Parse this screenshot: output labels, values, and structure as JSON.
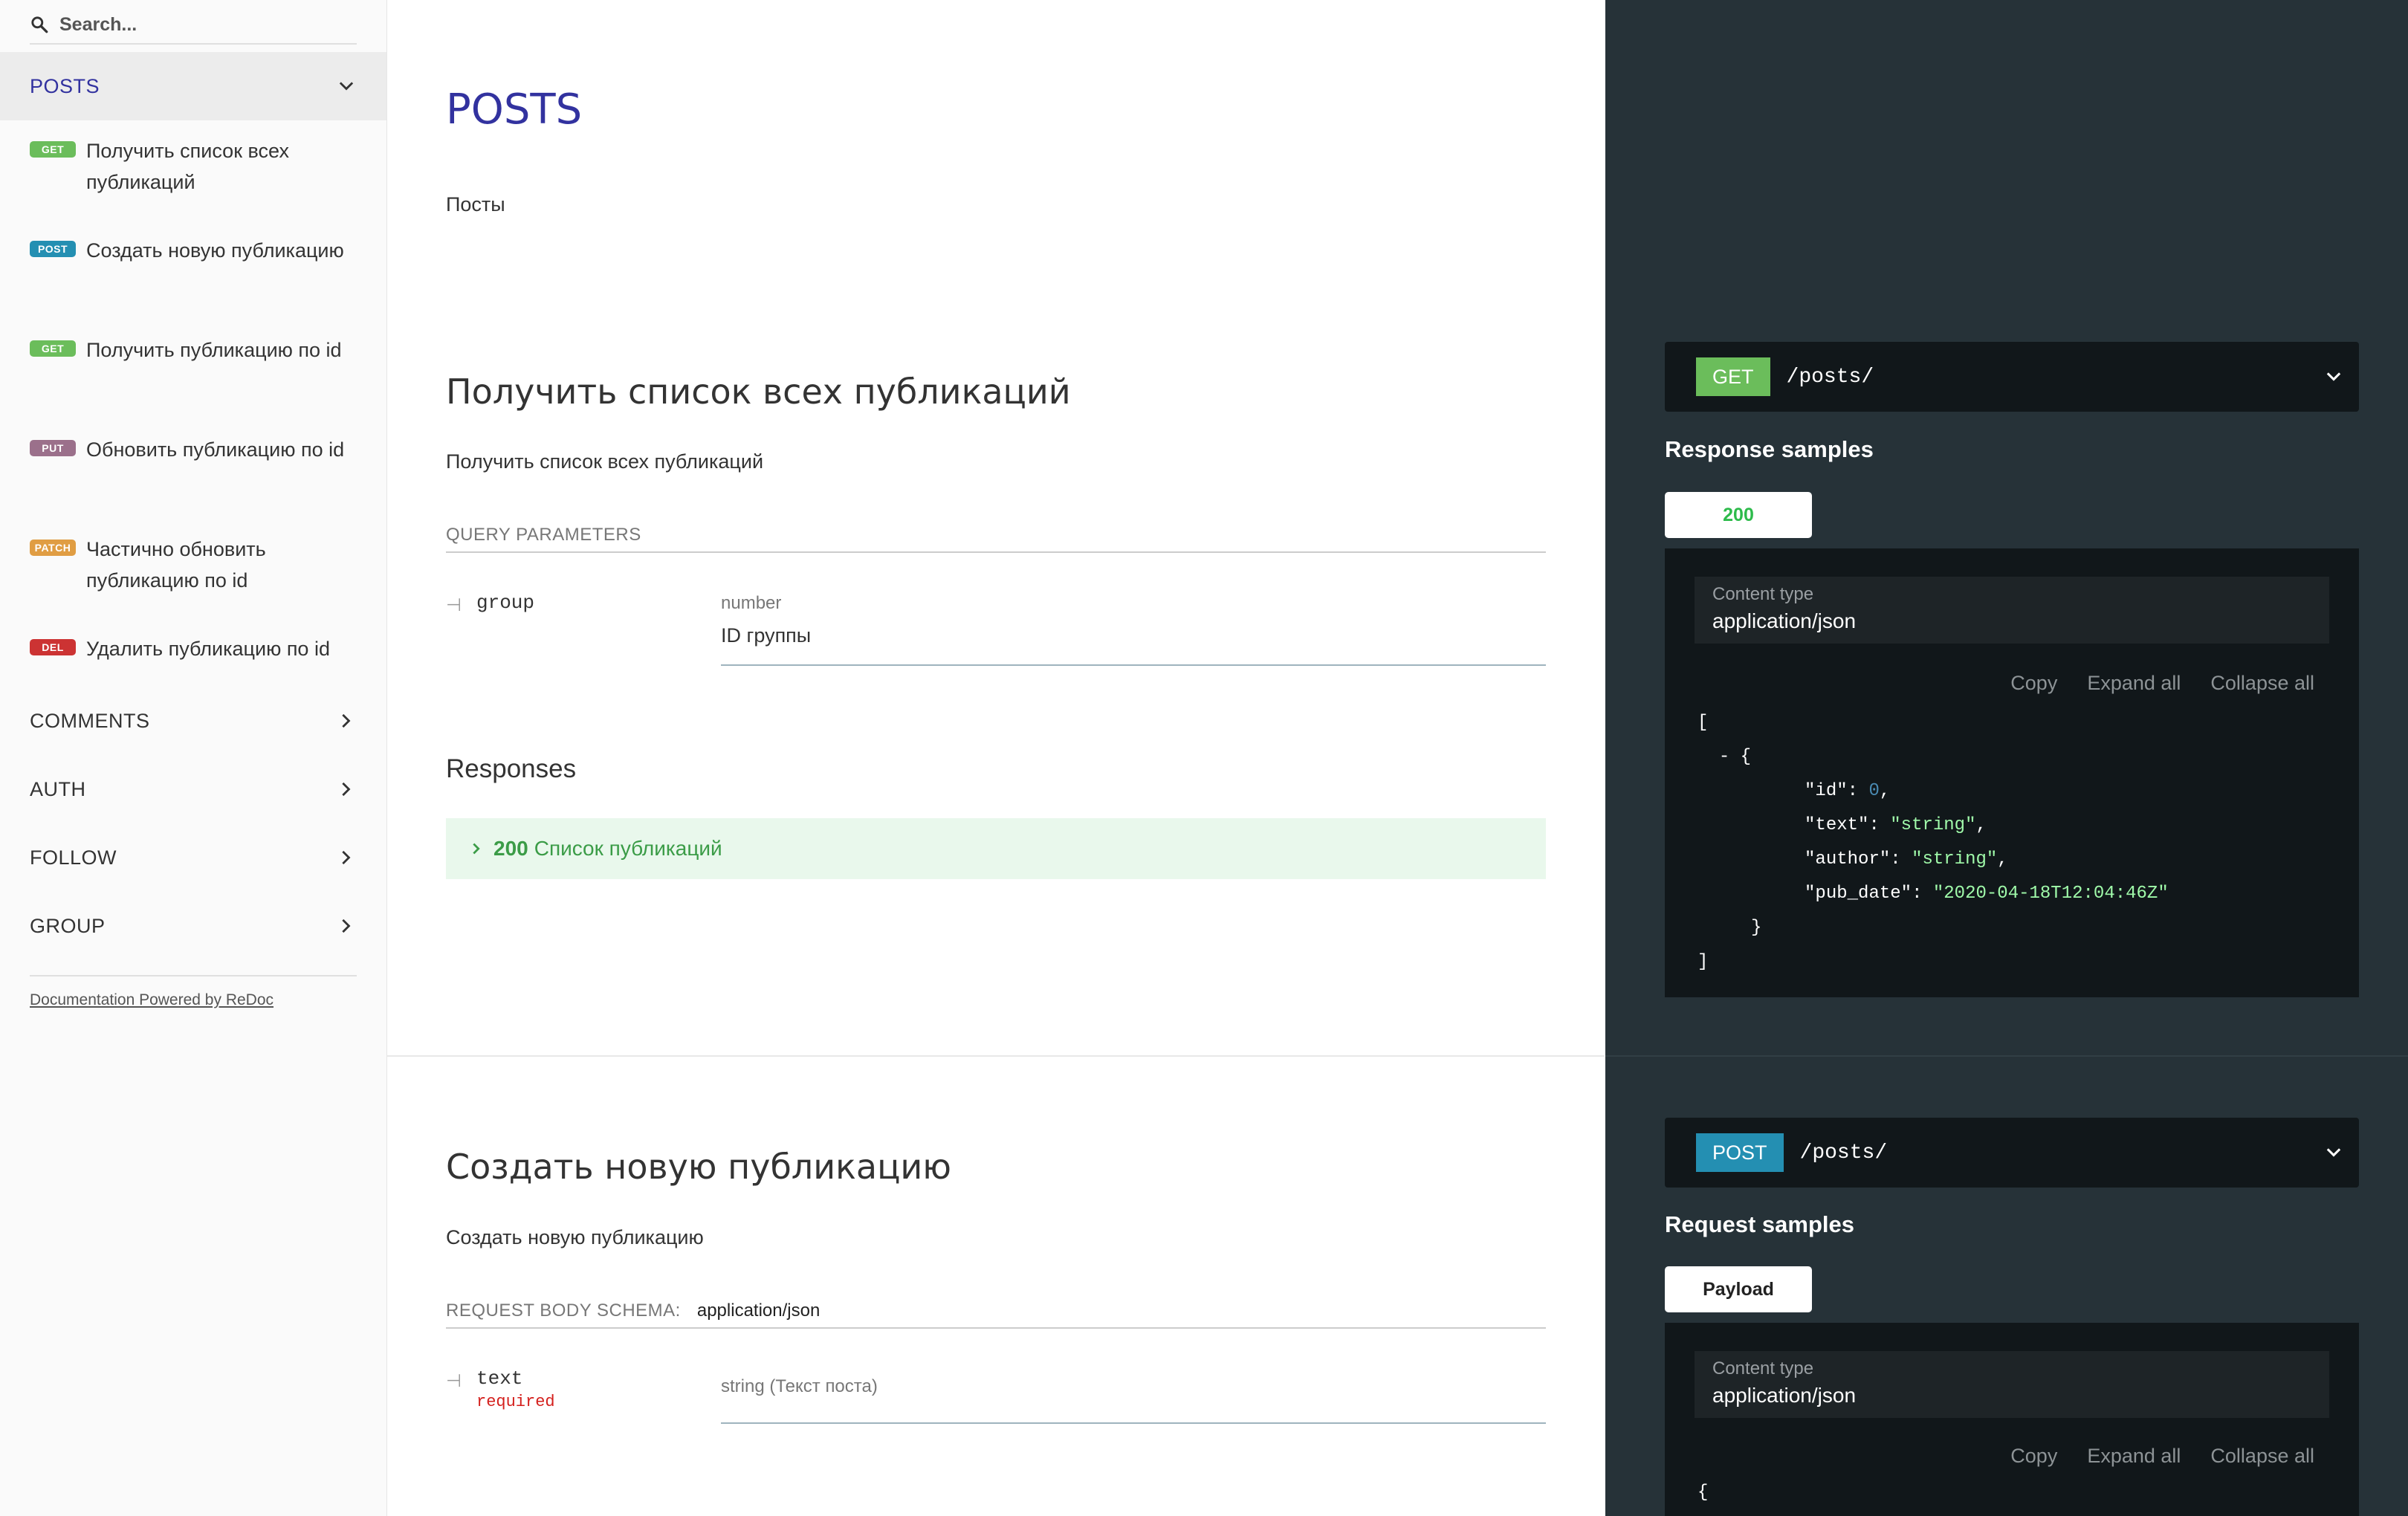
{
  "search": {
    "placeholder": "Search..."
  },
  "sidebar": {
    "groups": [
      {
        "label": "POSTS"
      },
      {
        "label": "COMMENTS"
      },
      {
        "label": "AUTH"
      },
      {
        "label": "FOLLOW"
      },
      {
        "label": "GROUP"
      }
    ],
    "operations": [
      {
        "method": "GET",
        "label": "Получить список всех публикаций"
      },
      {
        "method": "POST",
        "label": "Создать новую публикацию"
      },
      {
        "method": "GET",
        "label": "Получить публикацию по id"
      },
      {
        "method": "PUT",
        "label": "Обновить публикацию по id"
      },
      {
        "method": "PATCH",
        "label": "Частично обновить публикацию по id"
      },
      {
        "method": "DEL",
        "label": "Удалить публикацию по id"
      }
    ],
    "powered_by": "Documentation Powered by ReDoc"
  },
  "main": {
    "tag_title": "POSTS",
    "tag_description": "Посты",
    "op1": {
      "title": "Получить список всех публикаций",
      "description": "Получить список всех публикаций",
      "params_header": "QUERY PARAMETERS",
      "param_name": "group",
      "param_type": "number",
      "param_desc": "ID группы",
      "responses_title": "Responses",
      "response_code": "200",
      "response_desc": "Список публикаций"
    },
    "op2": {
      "title": "Создать новую публикацию",
      "description": "Создать новую публикацию",
      "schema_header": "REQUEST BODY SCHEMA:",
      "schema_type": "application/json",
      "field_name": "text",
      "field_required": "required",
      "field_type": "string (Текст поста)"
    }
  },
  "right": {
    "op1": {
      "method": "GET",
      "path": "/posts/",
      "samples_title": "Response samples",
      "tab": "200",
      "content_type_label": "Content type",
      "content_type": "application/json",
      "actions": {
        "copy": "Copy",
        "expand": "Expand all",
        "collapse": "Collapse all"
      },
      "json": {
        "open_bracket": "[",
        "item_open": "- {",
        "id_key": "\"id\"",
        "id_val": "0",
        "text_key": "\"text\"",
        "text_val": "\"string\"",
        "author_key": "\"author\"",
        "author_val": "\"string\"",
        "pubdate_key": "\"pub_date\"",
        "pubdate_val": "\"2020-04-18T12:04:46Z\"",
        "item_close": "}",
        "close_bracket": "]"
      }
    },
    "op2": {
      "method": "POST",
      "path": "/posts/",
      "samples_title": "Request samples",
      "tab": "Payload",
      "content_type_label": "Content type",
      "content_type": "application/json",
      "actions": {
        "copy": "Copy",
        "expand": "Expand all",
        "collapse": "Collapse all"
      },
      "json_open": "{"
    }
  },
  "colors": {
    "get": "#6bbd5b",
    "post": "#248fb2",
    "put": "#9b708b",
    "patch": "#e09d43",
    "delete": "#cc3333",
    "accent": "#32329f",
    "right_panel_bg": "#263238"
  }
}
